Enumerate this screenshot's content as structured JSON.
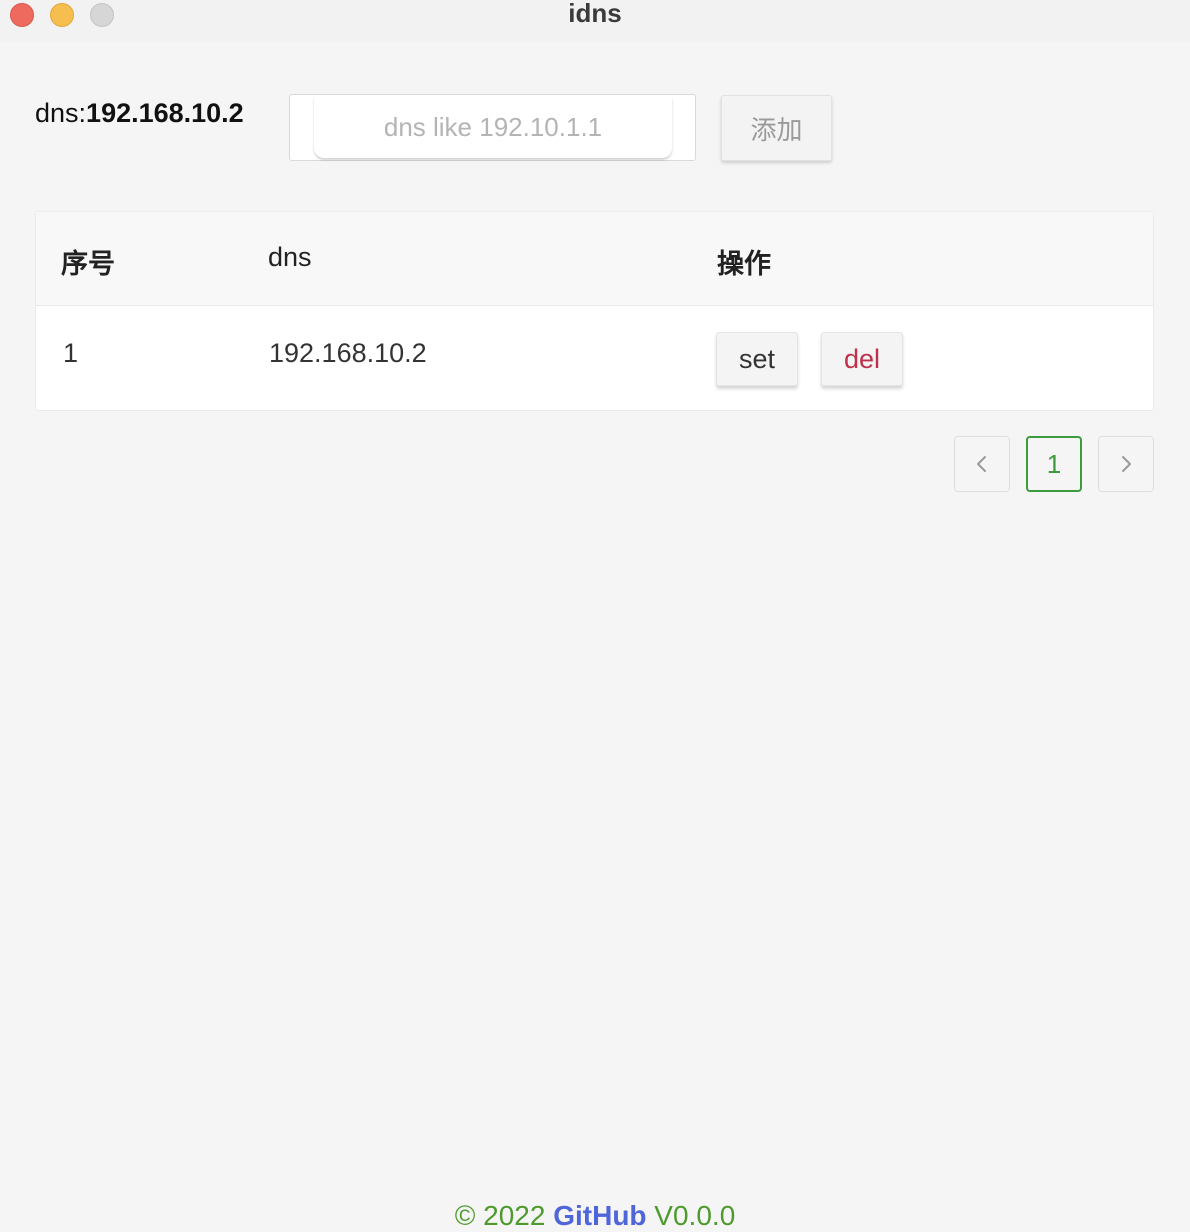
{
  "window": {
    "title": "idns"
  },
  "current": {
    "label": "dns:",
    "value": "192.168.10.2"
  },
  "add_form": {
    "placeholder": "dns like 192.10.1.1",
    "value": "",
    "button_label": "添加"
  },
  "table": {
    "headers": {
      "index": "序号",
      "dns": "dns",
      "ops": "操作"
    },
    "rows": [
      {
        "index": "1",
        "dns": "192.168.10.2",
        "set_label": "set",
        "del_label": "del"
      }
    ]
  },
  "pagination": {
    "current_page": "1",
    "prev_icon": "chevron-left-icon",
    "next_icon": "chevron-right-icon"
  },
  "footer": {
    "copyright": "© 2022 ",
    "github": "GitHub",
    "version": " V0.0.0"
  },
  "colors": {
    "accent_green": "#3d9b3d",
    "danger": "#c0304a",
    "link": "#4f66d9"
  }
}
